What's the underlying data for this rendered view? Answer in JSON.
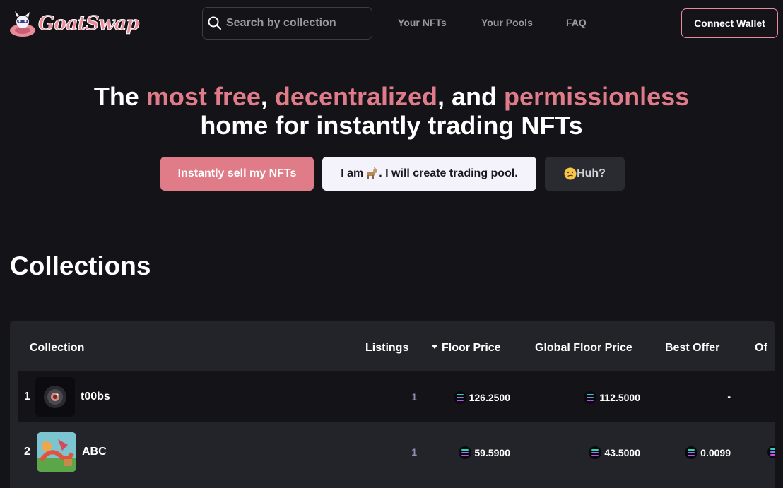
{
  "brand": {
    "name": "GoatSwap"
  },
  "search": {
    "placeholder": "Search by collection"
  },
  "nav": {
    "links": [
      "Your NFTs",
      "Your Pools",
      "FAQ"
    ],
    "connect_label": "Connect Wallet"
  },
  "hero": {
    "part1": "The ",
    "highlight1": "most free",
    "part2": ", ",
    "highlight2": "decentralized",
    "part3": ", and ",
    "highlight3": "permissionless",
    "line2": "home for instantly trading NFTs"
  },
  "cta": {
    "sell": "Instantly sell my NFTs",
    "pool_prefix": "I am ",
    "pool_suffix": ". I will create trading pool.",
    "huh_emoji": "😕",
    "huh": " Huh?"
  },
  "collections": {
    "title": "Collections",
    "headers": {
      "collection": "Collection",
      "listings": "Listings",
      "floor_price": "Floor Price",
      "global_floor_price": "Global Floor Price",
      "best_offer": "Best Offer",
      "offer_truncated": "Of"
    },
    "rows": [
      {
        "rank": "1",
        "name": "t00bs",
        "listings": "1",
        "floor_price": "126.2500",
        "global_floor_price": "112.5000",
        "best_offer": "-"
      },
      {
        "rank": "2",
        "name": "ABC",
        "listings": "1",
        "floor_price": "59.5900",
        "global_floor_price": "43.5000",
        "best_offer": "0.0099"
      }
    ]
  },
  "colors": {
    "accent": "#e07c8a",
    "background": "#131318",
    "card": "#23232a"
  },
  "icons": {
    "search": "search-icon",
    "sort": "caret-down-icon",
    "currency": "solana-icon",
    "goat": "goat-emoji"
  }
}
